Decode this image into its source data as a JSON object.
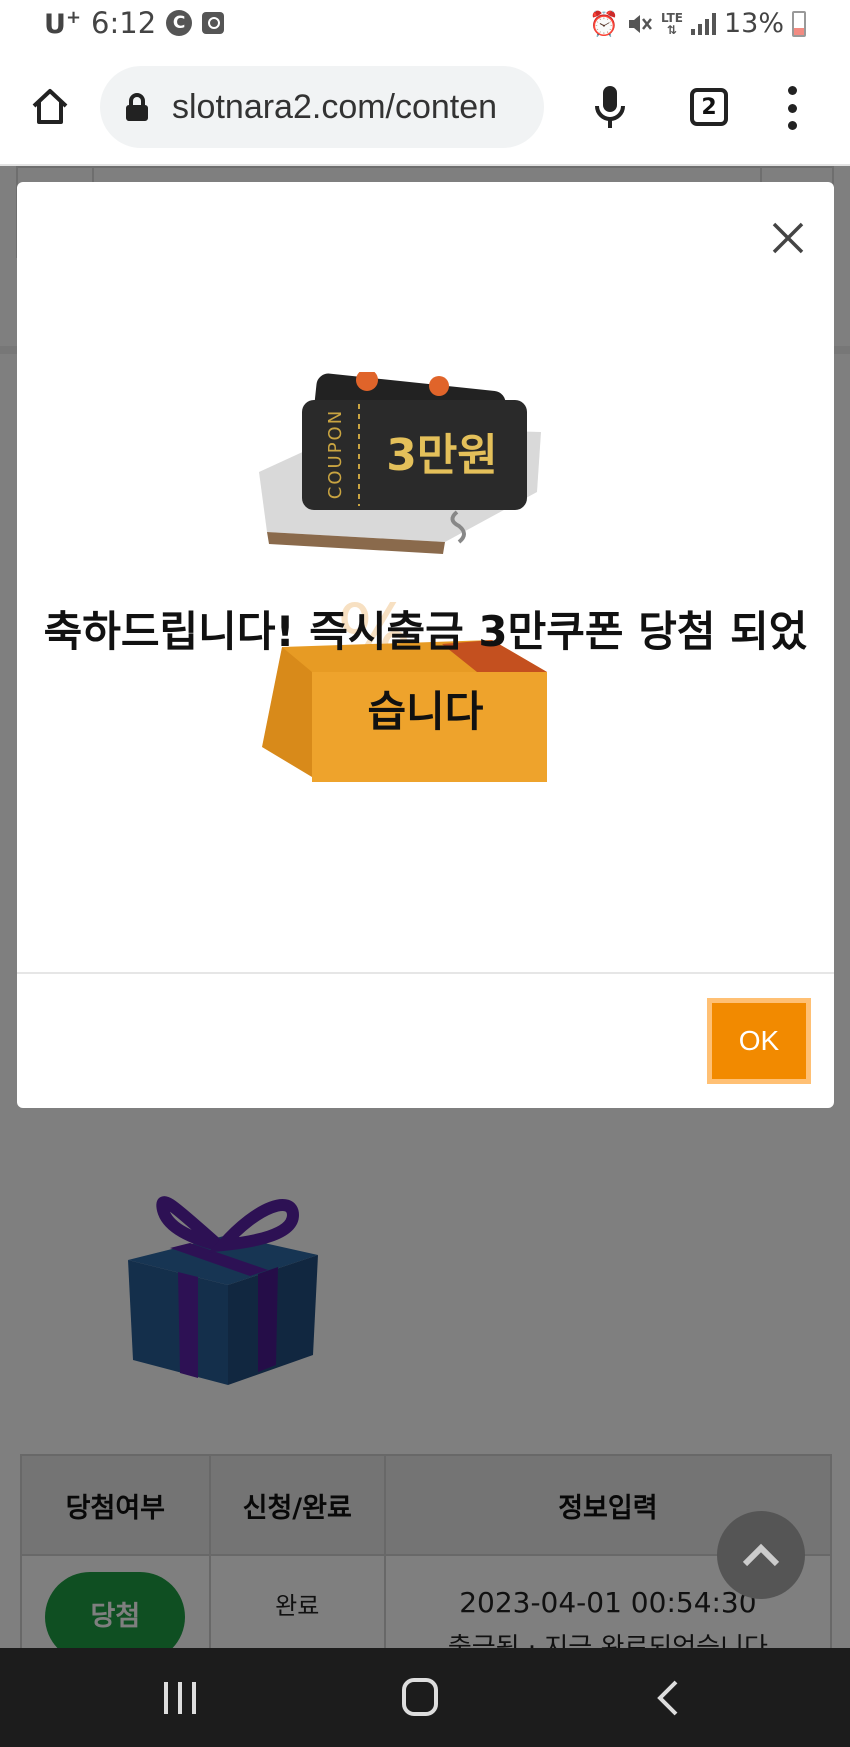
{
  "status_bar": {
    "carrier": "U",
    "carrier_sup": "+",
    "time": "6:12",
    "circle_icon_letter": "C",
    "network": "LTE",
    "battery": "13%"
  },
  "browser": {
    "url": "slotnara2.com/conten",
    "tab_count": "2"
  },
  "modal": {
    "message": "축하드립니다! 즉시출금 3만쿠폰 당첨 되었습니다",
    "ok_label": "OK",
    "coupon_label": "COUPON",
    "coupon_amount": "3만원"
  },
  "table": {
    "headers": [
      "당첨여부",
      "신청/완료",
      "정보입력"
    ],
    "row": {
      "status_badge": "당첨",
      "state": "완료",
      "datetime": "2023-04-01 00:54:30",
      "info": "출금됨 · 지금 완료되었습니다"
    }
  },
  "colors": {
    "ok_button": "#f28a00",
    "win_badge": "#1e9e45",
    "overlay": "rgba(0,0,0,0.5)"
  }
}
